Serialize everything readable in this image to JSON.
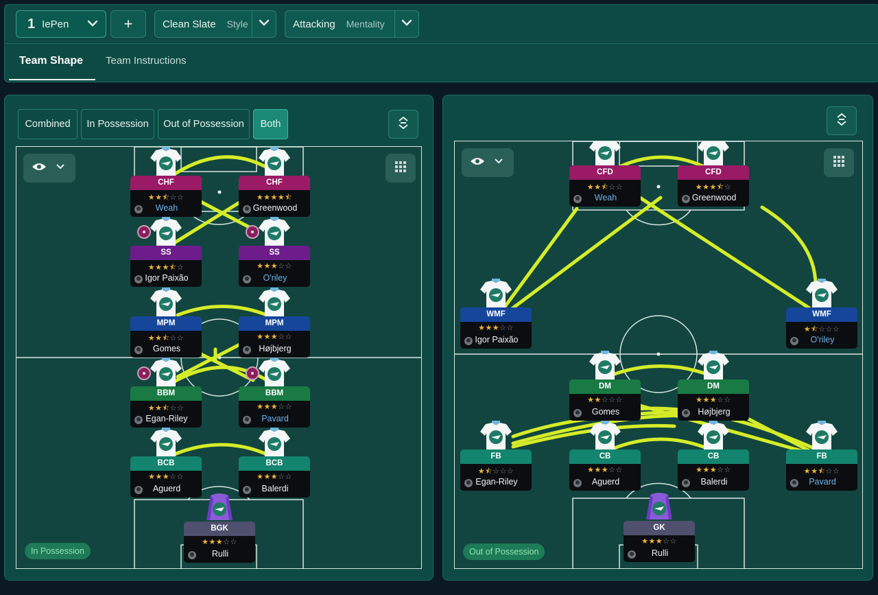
{
  "topbar": {
    "tactic_number": "1",
    "tactic_name": "IePen",
    "add_label": "+",
    "style_value": "Clean Slate",
    "style_label": "Style",
    "mentality_value": "Attacking",
    "mentality_label": "Mentality"
  },
  "tabs": [
    "Team Shape",
    "Team Instructions"
  ],
  "left_panel": {
    "filters": [
      "Combined",
      "In Possession",
      "Out of Possession",
      "Both"
    ],
    "active_filter": "Both",
    "badge": "In Possession",
    "players": [
      {
        "role": "CHF",
        "name": "Weah",
        "rating": 2.5,
        "name_color": "blue",
        "role_color": "#9a1a66"
      },
      {
        "role": "CHF",
        "name": "Greenwood",
        "rating": 4.5,
        "name_color": "white",
        "role_color": "#9a1a66"
      },
      {
        "role": "SS",
        "name": "Igor Paixão",
        "rating": 3.5,
        "name_color": "white",
        "role_color": "#6e1c8c"
      },
      {
        "role": "SS",
        "name": "O'riley",
        "rating": 3,
        "name_color": "blue",
        "role_color": "#6e1c8c"
      },
      {
        "role": "MPM",
        "name": "Gomes",
        "rating": 2.5,
        "name_color": "white",
        "role_color": "#16469c"
      },
      {
        "role": "MPM",
        "name": "Højbjerg",
        "rating": 3,
        "name_color": "white",
        "role_color": "#16469c"
      },
      {
        "role": "BBM",
        "name": "Egan-Riley",
        "rating": 2.5,
        "name_color": "white",
        "role_color": "#1a7a44"
      },
      {
        "role": "BBM",
        "name": "Pavard",
        "rating": 3,
        "name_color": "blue",
        "role_color": "#1a7a44"
      },
      {
        "role": "BCB",
        "name": "Aguerd",
        "rating": 3,
        "name_color": "white",
        "role_color": "#13846e"
      },
      {
        "role": "BCB",
        "name": "Balerdi",
        "rating": 3,
        "name_color": "white",
        "role_color": "#13846e"
      },
      {
        "role": "BGK",
        "name": "Rulli",
        "rating": 3,
        "name_color": "white",
        "role_color": "#4f4f6e"
      }
    ]
  },
  "right_panel": {
    "badge": "Out of Possession",
    "players": [
      {
        "role": "CFD",
        "name": "Weah",
        "rating": 2.5,
        "name_color": "blue",
        "role_color": "#9a1a66"
      },
      {
        "role": "CFD",
        "name": "Greenwood",
        "rating": 3.5,
        "name_color": "white",
        "role_color": "#9a1a66"
      },
      {
        "role": "WMF",
        "name": "Igor Paixão",
        "rating": 3,
        "name_color": "white",
        "role_color": "#16469c"
      },
      {
        "role": "WMF",
        "name": "O'riley",
        "rating": 1.5,
        "name_color": "blue",
        "role_color": "#16469c"
      },
      {
        "role": "DM",
        "name": "Gomes",
        "rating": 2,
        "name_color": "white",
        "role_color": "#1a7a44"
      },
      {
        "role": "DM",
        "name": "Højbjerg",
        "rating": 3,
        "name_color": "white",
        "role_color": "#1a7a44"
      },
      {
        "role": "FB",
        "name": "Egan-Riley",
        "rating": 1.5,
        "name_color": "white",
        "role_color": "#13846e"
      },
      {
        "role": "CB",
        "name": "Aguerd",
        "rating": 3,
        "name_color": "white",
        "role_color": "#13846e"
      },
      {
        "role": "CB",
        "name": "Balerdi",
        "rating": 3,
        "name_color": "white",
        "role_color": "#13846e"
      },
      {
        "role": "FB",
        "name": "Pavard",
        "rating": 2.5,
        "name_color": "blue",
        "role_color": "#13846e"
      },
      {
        "role": "GK",
        "name": "Rulli",
        "rating": 3,
        "name_color": "white",
        "role_color": "#4f4f6e"
      }
    ]
  },
  "icons": {
    "dropdown": "chevron-down-icon",
    "visibility": "eye-icon",
    "grid": "grid-icon",
    "swap": "swap-icon",
    "shirt": "team-shirt-icon",
    "goalkeeper_shirt": "goalkeeper-shirt-icon",
    "player_photo": "player-avatar-icon",
    "ball_carrier": "ball-marker-icon"
  },
  "colors": {
    "panel": "#0d4a43",
    "pitch": "#12453f",
    "link_line": "#d5ec29",
    "star": "#f0b43c",
    "active_filter": "#1a8a77"
  }
}
